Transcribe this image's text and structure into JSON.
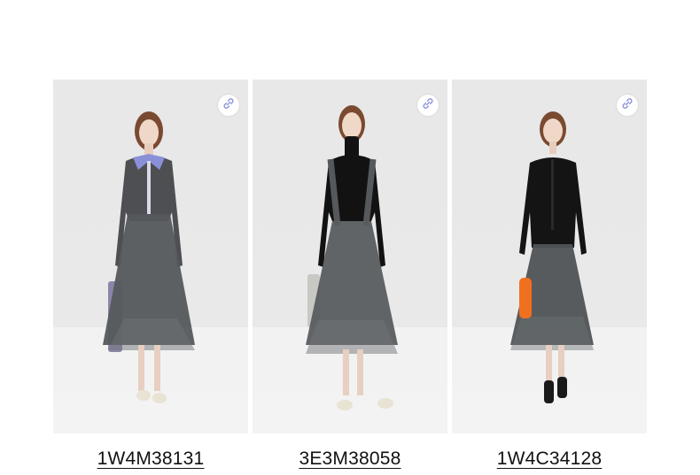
{
  "products": [
    {
      "code": "1W4M38131",
      "link_icon": "link-icon",
      "accent_color": "#8a90d8",
      "top_color": "#4d4f52",
      "skirt_color": "#55595b",
      "bag_color": "#8a86a8",
      "shoe_color": "#e9e3d4"
    },
    {
      "code": "3E3M38058",
      "link_icon": "link-icon",
      "top_color": "#121212",
      "skirt_color": "#595d5f",
      "bag_color": "#c9c9c4",
      "shoe_color": "#e9e3d4"
    },
    {
      "code": "1W4C34128",
      "link_icon": "link-icon",
      "top_color": "#141414",
      "skirt_color": "#4f5356",
      "bag_color": "#f07020",
      "shoe_color": "#1a1a1a"
    }
  ]
}
